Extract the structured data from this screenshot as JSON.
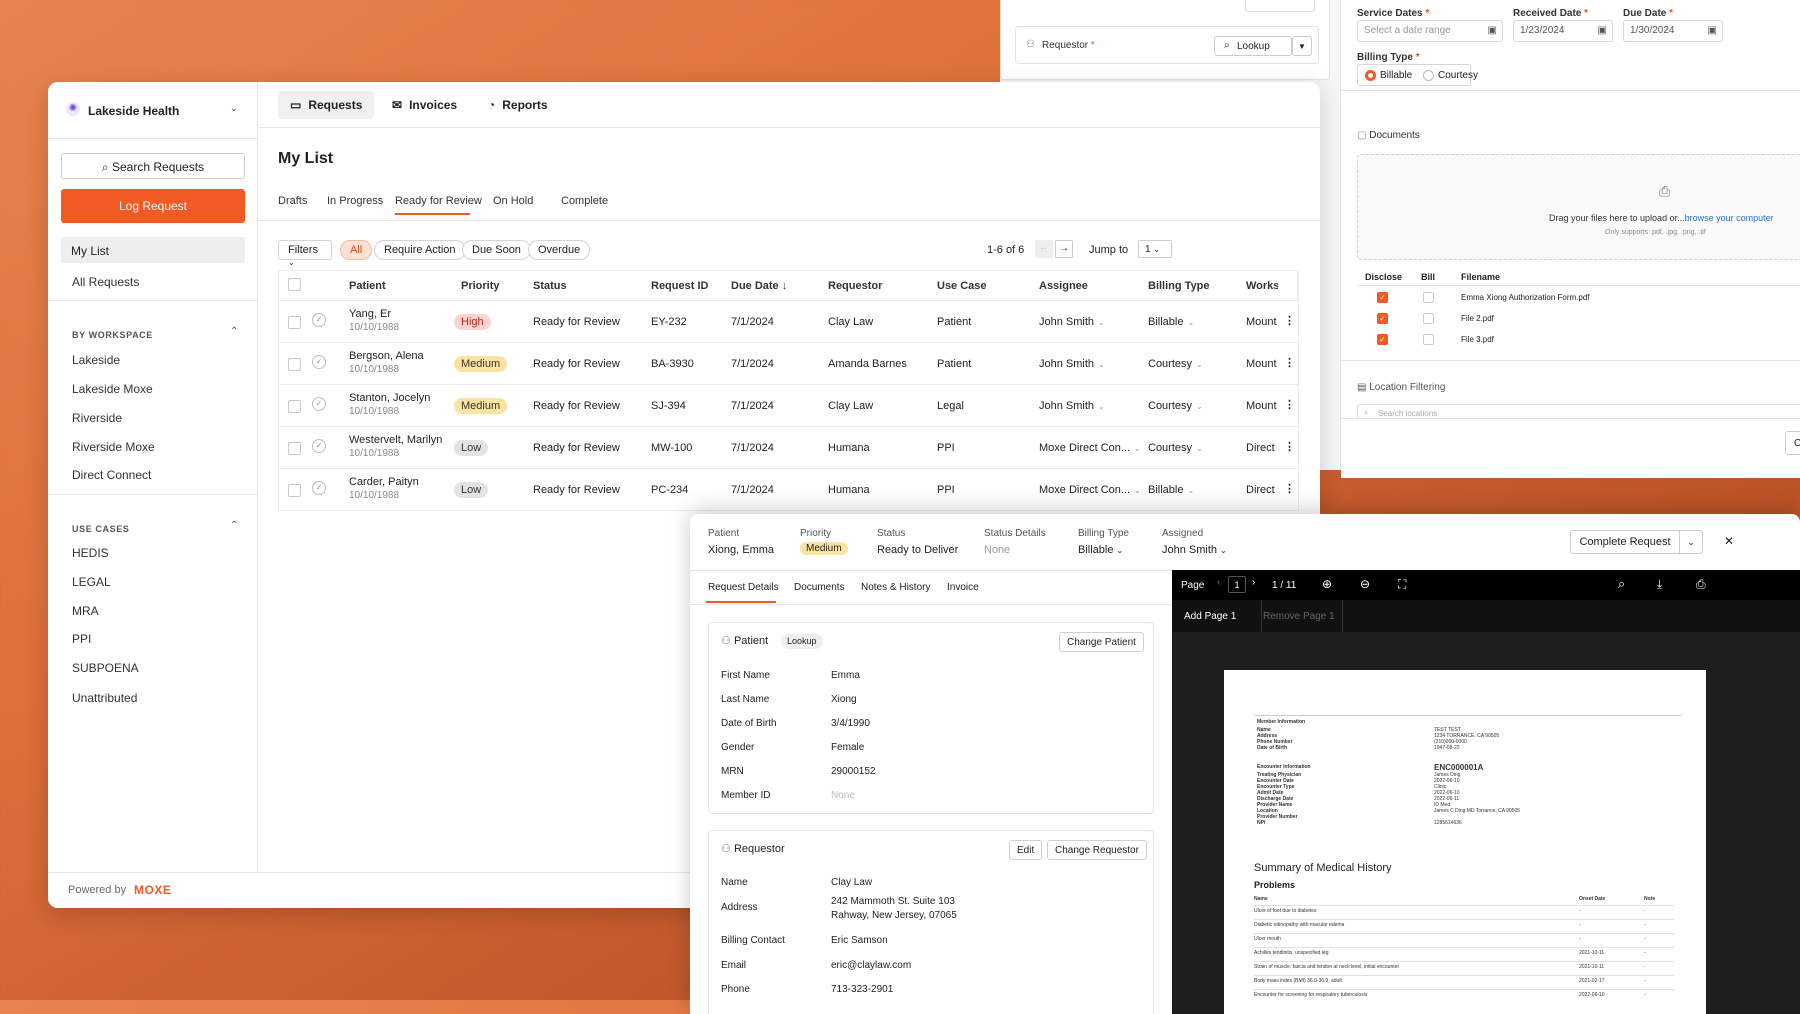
{
  "bgform": {
    "service_dates_label": "Service Dates",
    "service_dates_placeholder": "Select a date range",
    "received_label": "Received Date",
    "received_value": "1/23/2024",
    "due_label": "Due Date",
    "due_value": "1/30/2024",
    "billing_type_label": "Billing Type",
    "billing_opt1": "Billable",
    "billing_opt2": "Courtesy",
    "requestor_label": "Requestor",
    "lookup": "Lookup",
    "documents_title": "Documents",
    "drop_text": "Drag your files here to upload or...",
    "browse": "browse your computer",
    "supports": "Only supports .pdf, .jpg, .png, .tif",
    "col_disclose": "Disclose",
    "col_bill": "Bill",
    "col_filename": "Filename",
    "files": [
      "Emma Xiong Authorization Form.pdf",
      "File 2.pdf",
      "File 3.pdf"
    ],
    "location_title": "Location Filtering",
    "search_locations": "Search locations",
    "cancel_partial": "Ca"
  },
  "sidebar": {
    "org": "Lakeside Health",
    "search": "Search Requests",
    "log": "Log Request",
    "my_list": "My List",
    "all_requests": "All Requests",
    "by_workspace": "BY WORKSPACE",
    "workspaces": [
      "Lakeside",
      "Lakeside Moxe",
      "Riverside",
      "Riverside Moxe",
      "Direct Connect"
    ],
    "use_cases_h": "USE CASES",
    "use_cases": [
      "HEDIS",
      "LEGAL",
      "MRA",
      "PPI",
      "SUBPOENA",
      "Unattributed"
    ],
    "powered": "Powered by",
    "brand": "MOXE"
  },
  "nav": {
    "requests": "Requests",
    "invoices": "Invoices",
    "reports": "Reports"
  },
  "list": {
    "title": "My List",
    "tabs": [
      "Drafts",
      "In Progress",
      "Ready for Review",
      "On Hold",
      "Complete"
    ],
    "filters": "Filters",
    "chips": [
      "All",
      "Require Action",
      "Due Soon",
      "Overdue"
    ],
    "count": "1-6 of 6",
    "jump": "Jump to",
    "page": "1",
    "headers": [
      "Patient",
      "Priority",
      "Status",
      "Request ID",
      "Due Date",
      "Requestor",
      "Use Case",
      "Assignee",
      "Billing Type",
      "Works"
    ],
    "rows": [
      {
        "name": "Yang, Er",
        "dob": "10/10/1988",
        "priority": "High",
        "status": "Ready for Review",
        "id": "EY-232",
        "due": "7/1/2024",
        "requestor": "Clay Law",
        "use": "Patient",
        "assignee": "John Smith",
        "billing": "Billable",
        "ws": "Mount"
      },
      {
        "name": "Bergson, Alena",
        "dob": "10/10/1988",
        "priority": "Medium",
        "status": "Ready for Review",
        "id": "BA-3930",
        "due": "7/1/2024",
        "requestor": "Amanda Barnes",
        "use": "Patient",
        "assignee": "John Smith",
        "billing": "Courtesy",
        "ws": "Mount"
      },
      {
        "name": "Stanton, Jocelyn",
        "dob": "10/10/1988",
        "priority": "Medium",
        "status": "Ready for Review",
        "id": "SJ-394",
        "due": "7/1/2024",
        "requestor": "Clay Law",
        "use": "Legal",
        "assignee": "John Smith",
        "billing": "Courtesy",
        "ws": "Mount"
      },
      {
        "name": "Westervelt, Marilyn",
        "dob": "10/10/1988",
        "priority": "Low",
        "status": "Ready for Review",
        "id": "MW-100",
        "due": "7/1/2024",
        "requestor": "Humana",
        "use": "PPI",
        "assignee": "Moxe Direct Con...",
        "billing": "Courtesy",
        "ws": "Direct"
      },
      {
        "name": "Carder, Paityn",
        "dob": "10/10/1988",
        "priority": "Low",
        "status": "Ready for Review",
        "id": "PC-234",
        "due": "7/1/2024",
        "requestor": "Humana",
        "use": "PPI",
        "assignee": "Moxe Direct Con...",
        "billing": "Billable",
        "ws": "Direct"
      }
    ]
  },
  "detail": {
    "h_patient": "Patient",
    "v_patient": "Xiong, Emma",
    "h_priority": "Priority",
    "v_priority": "Medium",
    "h_status": "Status",
    "v_status": "Ready to Deliver",
    "h_details": "Status Details",
    "v_details": "None",
    "h_billing": "Billing Type",
    "v_billing": "Billable",
    "h_assigned": "Assigned",
    "v_assigned": "John Smith",
    "complete": "Complete Request",
    "tabs": [
      "Request Details",
      "Documents",
      "Notes & History",
      "Invoice"
    ],
    "patient_title": "Patient",
    "lookup": "Lookup",
    "change_patient": "Change Patient",
    "patient_fields": [
      [
        "First Name",
        "Emma"
      ],
      [
        "Last Name",
        "Xiong"
      ],
      [
        "Date of Birth",
        "3/4/1990"
      ],
      [
        "Gender",
        "Female"
      ],
      [
        "MRN",
        "29000152"
      ],
      [
        "Member ID",
        "None"
      ]
    ],
    "requestor_title": "Requestor",
    "edit": "Edit",
    "change_requestor": "Change Requestor",
    "req_name_l": "Name",
    "req_name": "Clay Law",
    "req_addr_l": "Address",
    "req_addr1": "242 Mammoth St. Suite 103",
    "req_addr2": "Rahway, New Jersey, 07065",
    "req_bc_l": "Billing Contact",
    "req_bc": "Eric Samson",
    "req_email_l": "Email",
    "req_email": "eric@claylaw.com",
    "req_phone_l": "Phone",
    "req_phone": "713-323-2901"
  },
  "viewer": {
    "page": "Page",
    "page_num": "1",
    "page_total": "1 / 11",
    "add_page": "Add Page 1",
    "remove_page": "Remove Page 1",
    "member_info": "Member Information",
    "member_rows": [
      [
        "Name",
        "TEST TEST"
      ],
      [
        "Address",
        "1234 TORRANCE, CA 90505"
      ],
      [
        "Phone Number",
        "(310)000-0000"
      ],
      [
        "Date of Birth",
        "1947-08-22"
      ]
    ],
    "enc_info": "Encounter Information",
    "enc_id": "ENC000001A",
    "enc_rows": [
      [
        "Treating Physician",
        "James Ding"
      ],
      [
        "Encounter Date",
        "2022-06-10"
      ],
      [
        "Encounter Type",
        "Clinic"
      ],
      [
        "Admit Date",
        "2022-06-10"
      ],
      [
        "Discharge Date",
        "2022-06-11"
      ],
      [
        "Provider Name",
        "ID Med"
      ],
      [
        "Location",
        "James C Ding MD Torrance, CA 90505"
      ],
      [
        "Provider Number",
        ""
      ],
      [
        "NPI",
        "1285614636"
      ]
    ],
    "summary": "Summary of Medical History",
    "problems": "Problems",
    "p_cols": [
      "Name",
      "Onset Date",
      "Note"
    ],
    "p_rows": [
      [
        "Ulcer of foot due to diabetes",
        "-",
        "-"
      ],
      [
        "Diabetic retinopathy with macular edema",
        "-",
        "-"
      ],
      [
        "Ulcer mouth",
        "-",
        "-"
      ],
      [
        "Achilles tendinitis, unspecified leg",
        "2021-10-11",
        "-"
      ],
      [
        "Strain of muscle, fascia and tendon at neck level, initial encounter",
        "2021-10-11",
        "-"
      ],
      [
        "Body mass index (BMI) 36.0-36.9, adult",
        "2021-02-17",
        "-"
      ],
      [
        "Encounter for screening for respiratory tuberculosis",
        "2022-06-10",
        "-"
      ]
    ]
  },
  "colors": {
    "accent": "#f15a22",
    "high_bg": "#fbd3d3",
    "medium_bg": "#fbe3a1",
    "low_bg": "#e3e3e3"
  }
}
